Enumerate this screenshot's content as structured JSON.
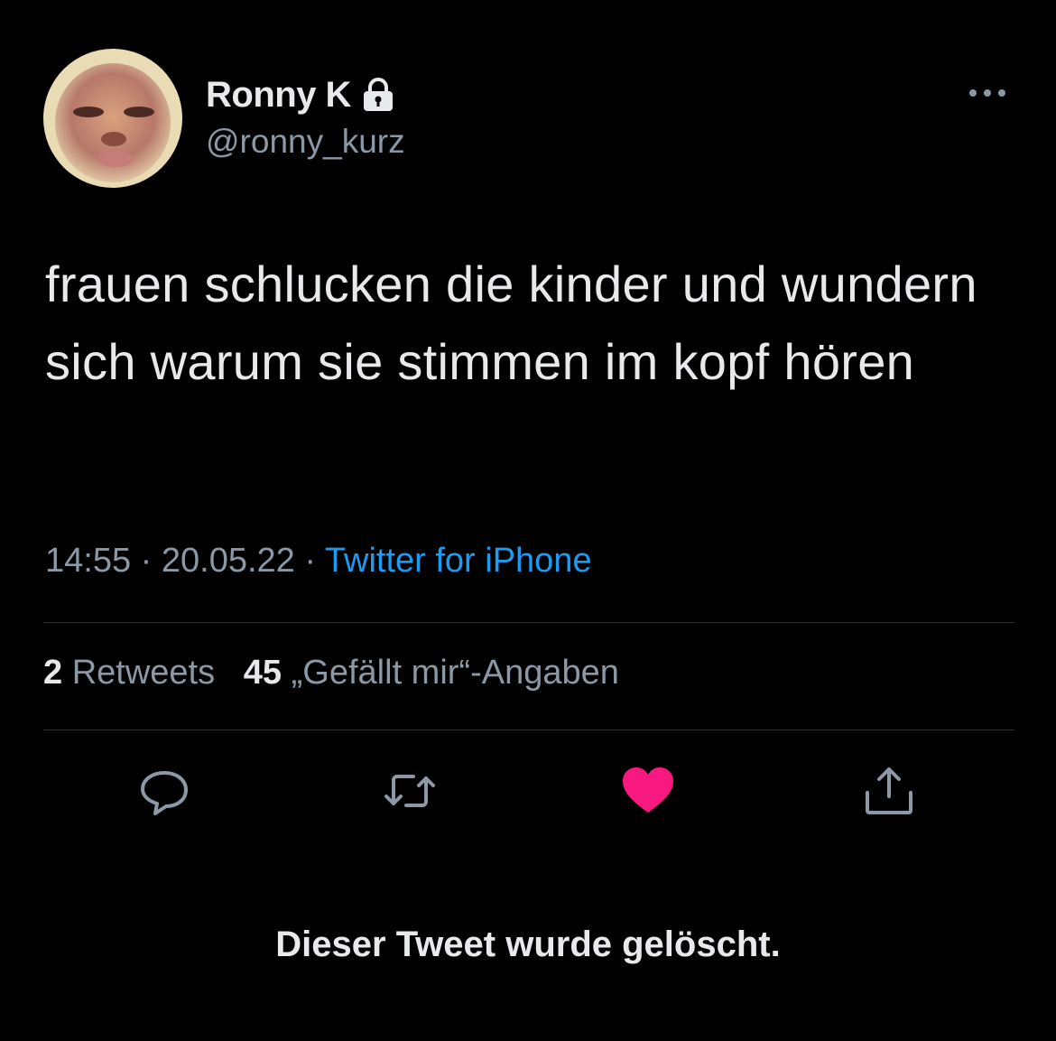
{
  "author": {
    "display_name": "Ronny K",
    "handle": "@ronny_kurz",
    "protected_icon": "lock-icon",
    "avatar": "profile-photo"
  },
  "menu_icon": "more-horizontal-icon",
  "tweet": {
    "text": "frauen schlucken die kinder und wundern sich warum sie stimmen im kopf hören",
    "time": "14:55",
    "separator": "·",
    "date": "20.05.22",
    "source": "Twitter for iPhone"
  },
  "stats": {
    "retweets_count": "2",
    "retweets_label": "Retweets",
    "likes_count": "45",
    "likes_label": "„Gefällt mir“-Angaben"
  },
  "actions": [
    {
      "name": "reply",
      "icon": "reply-bubble-icon"
    },
    {
      "name": "retweet",
      "icon": "retweet-icon"
    },
    {
      "name": "like",
      "icon": "heart-icon",
      "active": true
    },
    {
      "name": "share",
      "icon": "share-icon"
    }
  ],
  "colors": {
    "background": "#000000",
    "text": "#e7e9ea",
    "secondary": "#8b98a5",
    "link": "#1d9bf0",
    "like": "#f91880",
    "divider": "#2f3336"
  },
  "notice": "Dieser Tweet wurde gelöscht."
}
